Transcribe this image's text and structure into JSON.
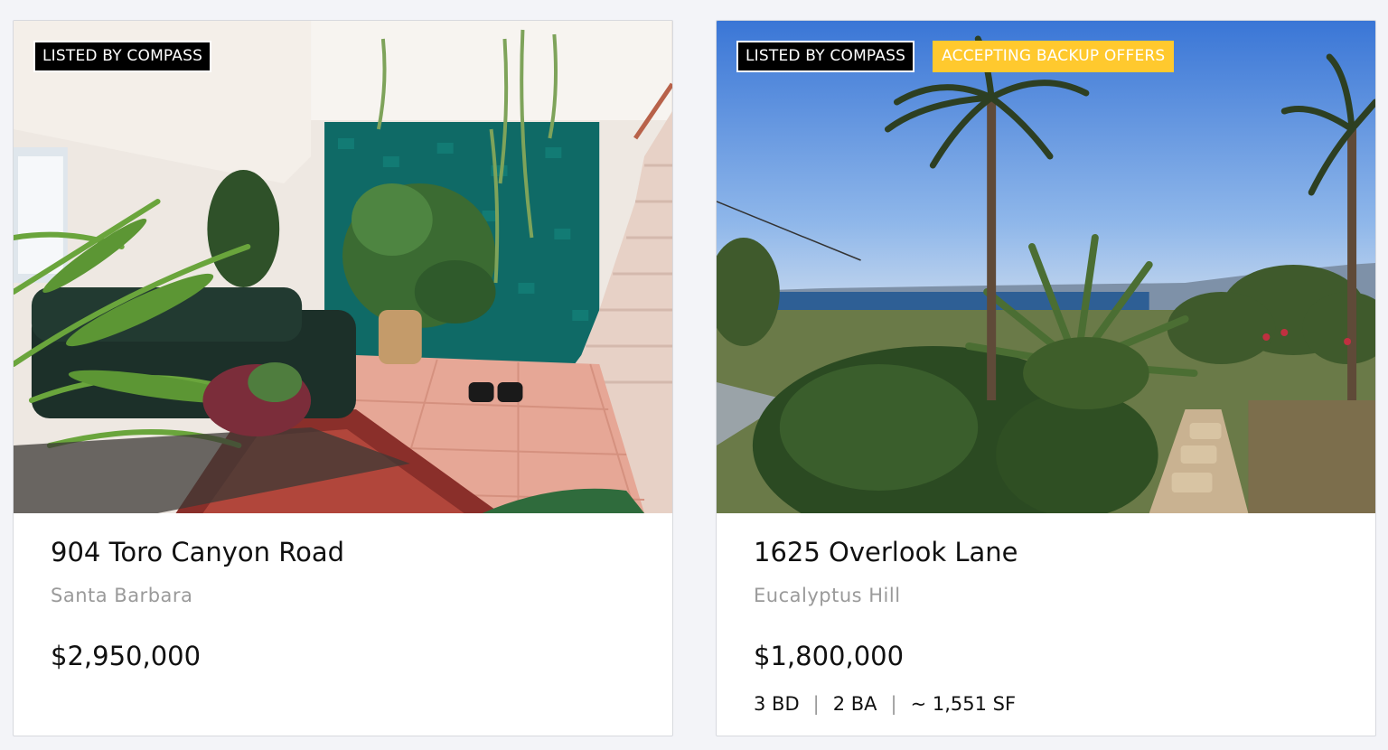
{
  "listings": [
    {
      "badges": [
        "LISTED BY COMPASS"
      ],
      "address": "904 Toro Canyon Road",
      "locality": "Santa Barbara",
      "price": "$2,950,000"
    },
    {
      "badges": [
        "LISTED BY COMPASS",
        "ACCEPTING BACKUP OFFERS"
      ],
      "address": "1625 Overlook Lane",
      "locality": "Eucalyptus Hill",
      "price": "$1,800,000",
      "specs": {
        "beds": "3 BD",
        "baths": "2 BA",
        "area": "~ 1,551 SF",
        "separator": "|"
      }
    }
  ],
  "colors": {
    "badge_dark": "#000000",
    "badge_yellow": "#ffc92e",
    "muted_text": "#9a9a9a",
    "page_bg": "#f3f4f8"
  }
}
